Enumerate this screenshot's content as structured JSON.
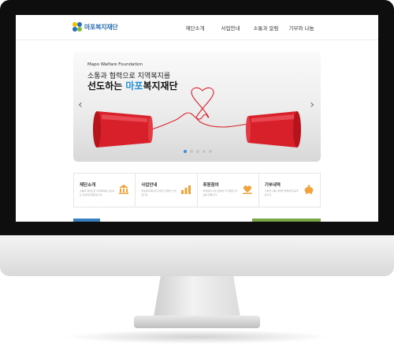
{
  "site": {
    "logo_text": "마포복지재단"
  },
  "nav": {
    "items": [
      "재단소개",
      "사업안내",
      "소통과 알림",
      "기부와 나눔"
    ]
  },
  "hero": {
    "kicker": "Mapo Walfare Foundation",
    "line1": "소통과 협력으로 지역복지를",
    "line2_lead": "선도하는 ",
    "line2_accent": "마포",
    "line2_tail": "복지재단",
    "prev_symbol": "‹",
    "next_symbol": "›",
    "slide_count": 5,
    "active_slide": 1
  },
  "cards": [
    {
      "title": "재단소개",
      "desc": "소통과 협력으로 지역복지를 선도하는 마포복지재단입니다.",
      "icon": "building-icon",
      "icon_color": "#f2a23a"
    },
    {
      "title": "사업안내",
      "desc": "마포복지재단의 다양한 사업을 소개합니다.",
      "icon": "chart-icon",
      "icon_color": "#f2a23a"
    },
    {
      "title": "후원참여",
      "desc": "여러분의 나눔 참여로 더 따뜻한 마포를 만듭니다.",
      "icon": "heart-hand-icon",
      "icon_color": "#f2a23a"
    },
    {
      "title": "기부내역",
      "desc": "기부금 사용 내역을 투명하게 공개합니다.",
      "icon": "piggy-bank-icon",
      "icon_color": "#f2a23a"
    }
  ],
  "colors": {
    "brand_blue": "#1f8fd6",
    "accent_orange": "#f2a23a",
    "cup_red": "#d8202a"
  }
}
